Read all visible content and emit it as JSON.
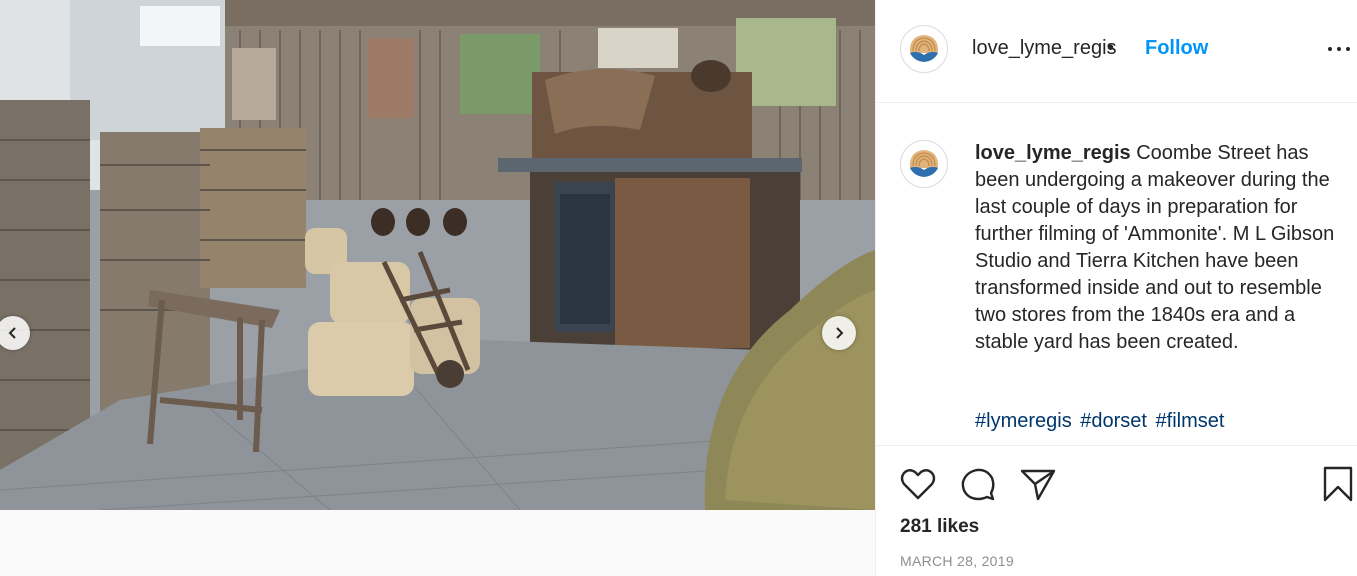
{
  "post": {
    "username": "love_lyme_regis",
    "separator": "•",
    "follow_label": "Follow",
    "caption": "Coombe Street has been undergoing a makeover during the last couple of days in preparation for further filming of 'Ammonite'. M L Gibson Studio and Tierra Kitchen have been transformed inside and out to resemble two stores from the 1840s era and a stable yard has been created.",
    "hashtags": [
      "#lymeregis",
      "#dorset",
      "#filmset"
    ],
    "likes": "281 likes",
    "date": "MARCH 28, 2019"
  },
  "icons": {
    "more": "more-options-icon",
    "prev": "chevron-left-icon",
    "next": "chevron-right-icon",
    "like": "heart-icon",
    "comment": "comment-icon",
    "share": "paper-plane-icon",
    "save": "bookmark-icon"
  },
  "colors": {
    "accent": "#0095f6",
    "hashtag": "#00376b",
    "text": "#262626",
    "muted": "#8e8e8e",
    "divider": "#efefef"
  }
}
